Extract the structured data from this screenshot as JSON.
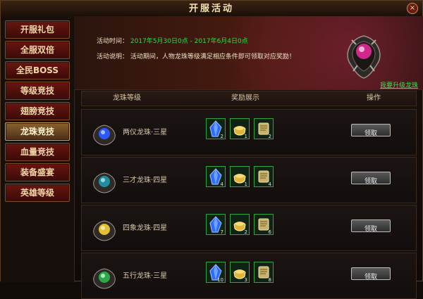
{
  "window": {
    "title": "开服活动",
    "close_label": "×"
  },
  "sidebar": {
    "items": [
      {
        "label": "开服礼包",
        "active": false
      },
      {
        "label": "全服双倍",
        "active": false
      },
      {
        "label": "全民BOSS",
        "active": false
      },
      {
        "label": "等级竞技",
        "active": false
      },
      {
        "label": "翅膀竞技",
        "active": false
      },
      {
        "label": "龙珠竞技",
        "active": true
      },
      {
        "label": "血量竞技",
        "active": false
      },
      {
        "label": "装备盛宴",
        "active": false
      },
      {
        "label": "英雄等级",
        "active": false
      }
    ]
  },
  "banner": {
    "time_label": "活动时间：",
    "time_value": "2017年5月30日0点 - 2017年6月4日0点",
    "desc_label": "活动说明：",
    "desc_value": "活动期间，人物龙珠等级满足相应条件即可领取对应奖励！",
    "upgrade_link": "我要升级龙珠"
  },
  "table": {
    "headers": {
      "col1": "龙珠等级",
      "col2": "奖励展示",
      "col3": "操作"
    },
    "rows": [
      {
        "name": "两仪龙珠·三星",
        "gem_color": "#2c58ff",
        "rewards": [
          {
            "icon": "crystal-icon",
            "count": "2"
          },
          {
            "icon": "gold-ingot-icon",
            "count": "1"
          },
          {
            "icon": "scroll-icon",
            "count": "2"
          }
        ],
        "button_label": "领取"
      },
      {
        "name": "三才龙珠·四星",
        "gem_color": "#1f8fa0",
        "rewards": [
          {
            "icon": "crystal-icon",
            "count": "4"
          },
          {
            "icon": "gold-ingot-icon",
            "count": "1"
          },
          {
            "icon": "scroll-icon",
            "count": "4"
          }
        ],
        "button_label": "领取"
      },
      {
        "name": "四象龙珠·四星",
        "gem_color": "#e0c230",
        "rewards": [
          {
            "icon": "crystal-icon",
            "count": "7"
          },
          {
            "icon": "gold-ingot-icon",
            "count": "2"
          },
          {
            "icon": "scroll-icon",
            "count": "6"
          }
        ],
        "button_label": "领取"
      },
      {
        "name": "五行龙珠·三星",
        "gem_color": "#2aa84a",
        "rewards": [
          {
            "icon": "crystal-icon",
            "count": "10"
          },
          {
            "icon": "gold-ingot-icon",
            "count": "3"
          },
          {
            "icon": "scroll-icon",
            "count": "8"
          }
        ],
        "button_label": "领取"
      }
    ]
  },
  "colors": {
    "accent_green": "#37d94a",
    "sidebar_item": "#6a1510",
    "sidebar_active": "#8a6130",
    "border_gold": "#7a4b27",
    "orb_pink": "#d0288a"
  }
}
